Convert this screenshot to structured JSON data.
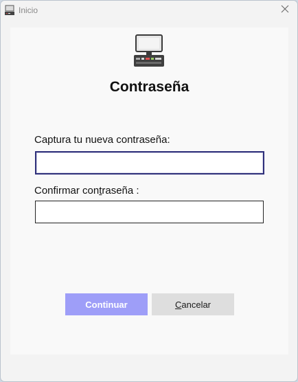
{
  "window": {
    "title": "Inicio",
    "close_glyph": "×"
  },
  "icons": {
    "app": "computer-terminal-icon",
    "logo": "cash-register-icon",
    "close": "close-icon"
  },
  "form": {
    "heading": "Contraseña",
    "new_password_label": "Captura tu nueva contraseña:",
    "new_password_value": "",
    "confirm_label_prefix": "Confirmar con",
    "confirm_label_mnemonic": "t",
    "confirm_label_suffix": "raseña :",
    "confirm_password_value": ""
  },
  "buttons": {
    "continue_label": "Continuar",
    "cancel_mnemonic": "C",
    "cancel_rest": "ancelar"
  },
  "colors": {
    "continue_bg": "#9e9ef8",
    "cancel_bg": "#dedede",
    "focus_border": "#2e2f7a"
  }
}
